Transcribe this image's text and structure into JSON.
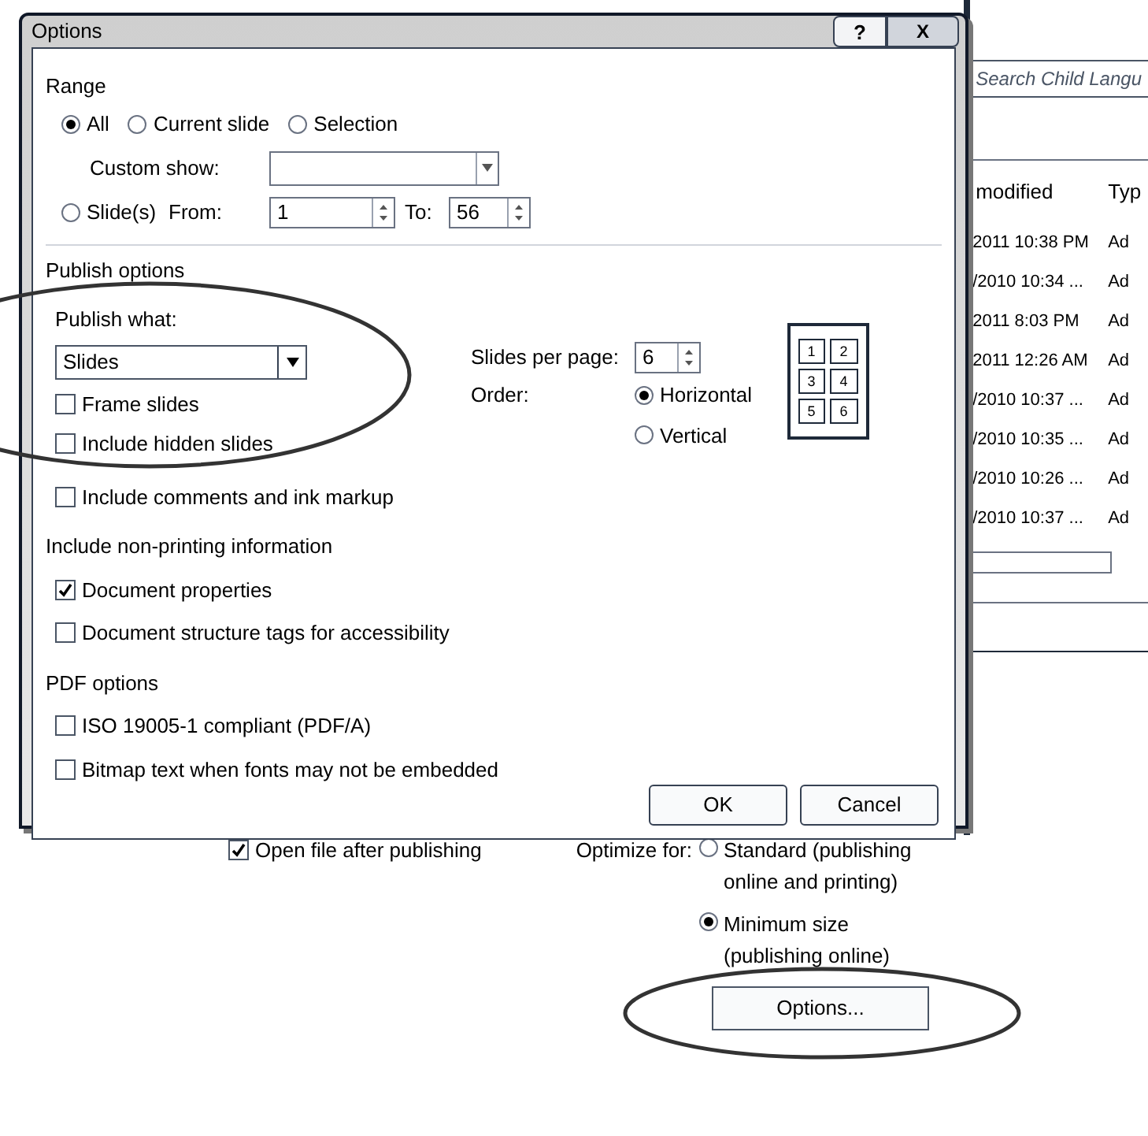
{
  "dialog": {
    "title": "Options",
    "help_button": "?",
    "close_button": "X",
    "range": {
      "heading": "Range",
      "options": [
        {
          "label": "All",
          "selected": true
        },
        {
          "label": "Current slide",
          "selected": false
        },
        {
          "label": "Selection",
          "selected": false
        },
        {
          "label": "Slide(s)",
          "selected": false
        }
      ],
      "custom_show_label": "Custom show:",
      "from_label": "From:",
      "from_value": "1",
      "to_label": "To:",
      "to_value": "56"
    },
    "publish_options": {
      "heading": "Publish options",
      "publish_what_label": "Publish what:",
      "publish_what_value": "Slides",
      "checkboxes": [
        {
          "label": "Frame slides",
          "checked": false
        },
        {
          "label": "Include hidden slides",
          "checked": false
        },
        {
          "label": "Include comments and ink markup",
          "checked": false
        }
      ],
      "slides_per_page_label": "Slides per page:",
      "slides_per_page_value": "6",
      "order_label": "Order:",
      "order_options": [
        {
          "label": "Horizontal",
          "selected": true
        },
        {
          "label": "Vertical",
          "selected": false
        }
      ],
      "preview_numbers": [
        "1",
        "2",
        "3",
        "4",
        "5",
        "6"
      ]
    },
    "non_printing": {
      "heading": "Include non-printing information",
      "checkboxes": [
        {
          "label": "Document properties",
          "checked": true
        },
        {
          "label": "Document structure tags for accessibility",
          "checked": false
        }
      ]
    },
    "pdf_options": {
      "heading": "PDF options",
      "checkboxes": [
        {
          "label": "ISO 19005-1 compliant (PDF/A)",
          "checked": false
        },
        {
          "label": "Bitmap text when fonts may not be embedded",
          "checked": false
        }
      ]
    },
    "buttons": [
      "OK",
      "Cancel"
    ]
  },
  "file_list": {
    "search_placeholder": "Search Child Langu",
    "columns": [
      "modified",
      "Typ"
    ],
    "rows": [
      {
        "modified": "2011 10:38 PM",
        "type": "Ad"
      },
      {
        "modified": "/2010 10:34 ...",
        "type": "Ad"
      },
      {
        "modified": "2011 8:03 PM",
        "type": "Ad"
      },
      {
        "modified": "2011 12:26 AM",
        "type": "Ad"
      },
      {
        "modified": "/2010 10:37 ...",
        "type": "Ad"
      },
      {
        "modified": "/2010 10:35 ...",
        "type": "Ad"
      },
      {
        "modified": "/2010 10:26 ...",
        "type": "Ad"
      },
      {
        "modified": "/2010 10:37 ...",
        "type": "Ad"
      }
    ]
  },
  "publish": {
    "open_after": {
      "label": "Open file after publishing",
      "checked": true
    },
    "optimize_label": "Optimize for:",
    "optimize_options": [
      {
        "label": "Standard (publishing online and printing)",
        "selected": false
      },
      {
        "label": "Minimum size (publishing online)",
        "selected": true
      }
    ],
    "options_button": "Options..."
  }
}
